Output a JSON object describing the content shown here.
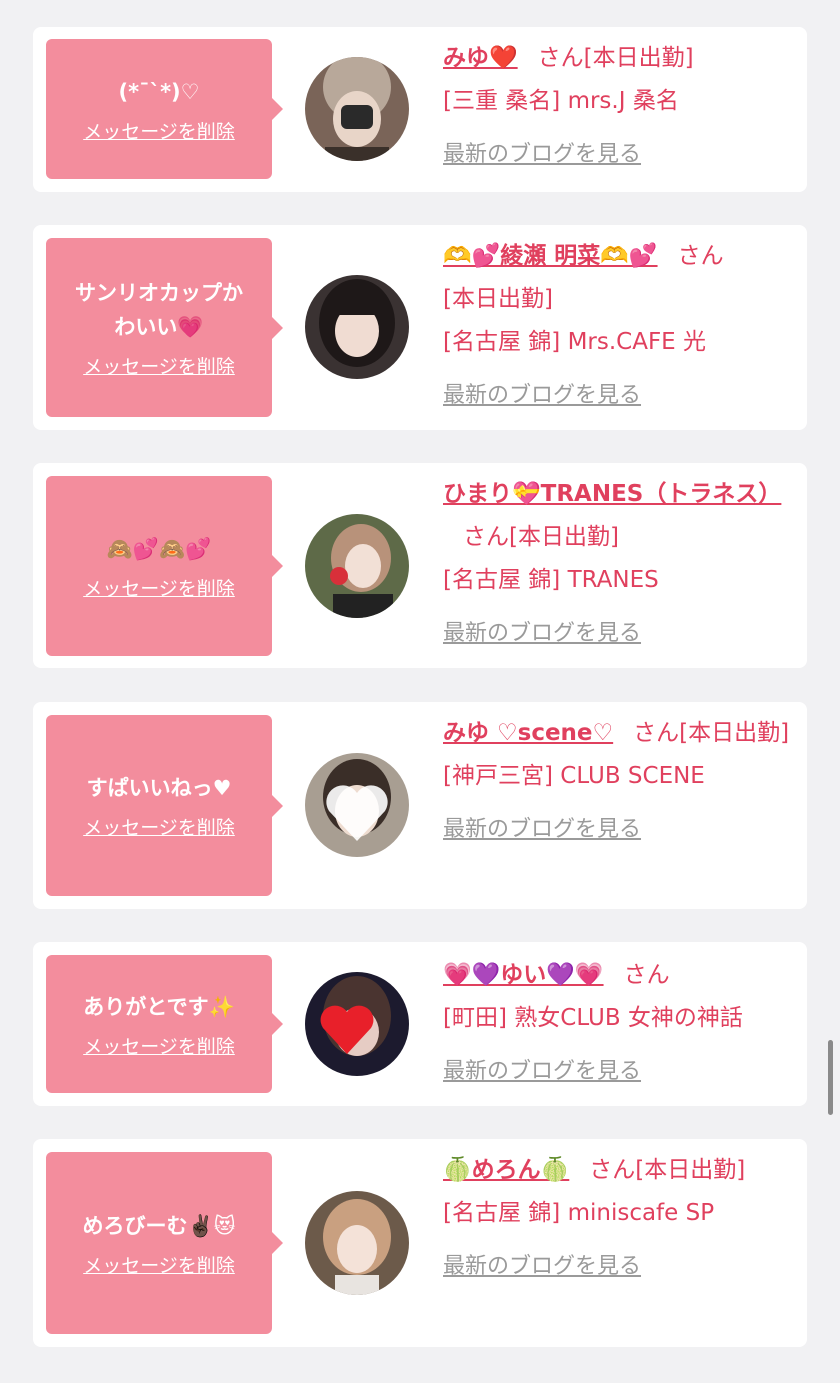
{
  "theme": {
    "bubble_color": "#f38d9d",
    "name_color": "#e0405e",
    "link_gray": "#9a9a9a"
  },
  "cards": [
    {
      "message": "(*¯`*)♡",
      "delete_label": "メッセージを削除",
      "name": "みゆ❤️",
      "san": "さん",
      "detail": "[本日出勤]\n[三重 桑名] mrs.J 桑名",
      "blog_label": "最新のブログを見る",
      "avatar_icon": "photo-avatar-1"
    },
    {
      "message": "サンリオカップか\nわいい💗",
      "delete_label": "メッセージを削除",
      "name": "🫶💕綾瀬 明菜🫶💕",
      "san": "さん",
      "detail": "[本日出勤]\n[名古屋 錦] Mrs.CAFE 光",
      "blog_label": "最新のブログを見る",
      "avatar_icon": "photo-avatar-2"
    },
    {
      "message": "🙈💕🙈💕",
      "delete_label": "メッセージを削除",
      "name": "ひまり💝TRANES（トラネス）",
      "san": "さん",
      "detail": "[本日出勤]\n[名古屋 錦] TRANES",
      "blog_label": "最新のブログを見る",
      "avatar_icon": "photo-avatar-3"
    },
    {
      "message": "すぱいいねっ♥",
      "delete_label": "メッセージを削除",
      "name": "みゆ ♡scene♡",
      "san": "さん",
      "detail": "[本日出勤]\n[神戸三宮] CLUB SCENE",
      "blog_label": "最新のブログを見る",
      "avatar_icon": "photo-avatar-4"
    },
    {
      "message": "ありがとです✨",
      "delete_label": "メッセージを削除",
      "name": "💗💜ゆい💜💗",
      "san": "さん",
      "detail": "[町田] 熟女CLUB 女神の神話",
      "blog_label": "最新のブログを見る",
      "avatar_icon": "photo-avatar-5"
    },
    {
      "message": "めろびーむ✌🏿😻",
      "delete_label": "メッセージを削除",
      "name": "🍈めろん🍈",
      "san": "さん",
      "detail": "[本日出勤]\n[名古屋 錦] miniscafe SP",
      "blog_label": "最新のブログを見る",
      "avatar_icon": "photo-avatar-6"
    }
  ]
}
